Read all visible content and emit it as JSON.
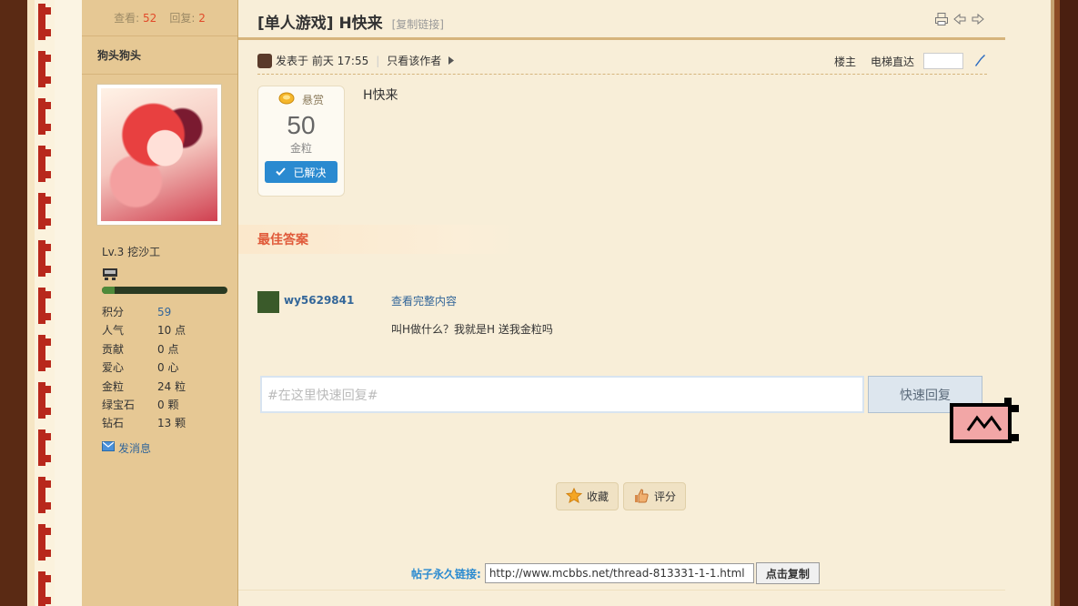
{
  "sidebar": {
    "stats": {
      "views_label": "查看:",
      "views": "52",
      "replies_label": "回复:",
      "replies": "2"
    },
    "username": "狗头狗头",
    "level": "Lv.3 挖沙工",
    "progress": 0.1,
    "fields": [
      {
        "key": "积分",
        "value": "59",
        "link": true
      },
      {
        "key": "人气",
        "value": "10 点"
      },
      {
        "key": "贡献",
        "value": "0 点"
      },
      {
        "key": "爱心",
        "value": "0 心"
      },
      {
        "key": "金粒",
        "value": "24 粒"
      },
      {
        "key": "绿宝石",
        "value": "0 颗"
      },
      {
        "key": "钻石",
        "value": "13 颗"
      }
    ],
    "message_label": "发消息"
  },
  "thread": {
    "title": "[单人游戏] H快来",
    "copy_link": "[复制链接]"
  },
  "meta": {
    "posted": "发表于 前天 17:55",
    "only_author": "只看该作者",
    "floor": "楼主",
    "elevator": "电梯直达"
  },
  "bounty": {
    "label": "悬赏",
    "amount": "50",
    "unit": "金粒",
    "status": "已解决"
  },
  "post": {
    "body": "H快来"
  },
  "best_answer": {
    "title": "最佳答案",
    "user": "wy5629841",
    "view_full": "查看完整内容",
    "text": "叫H做什么？我就是H 送我金粒吗"
  },
  "quick_reply": {
    "placeholder": "#在这里快速回复#",
    "button": "快速回复"
  },
  "actions": {
    "favorite": "收藏",
    "rate": "评分"
  },
  "permalink": {
    "label": "帖子永久链接:",
    "url": "http://www.mcbbs.net/thread-813331-1-1.html",
    "copy_button": "点击复制"
  },
  "colors": {
    "sidebar_bg": "#e6c894",
    "accent_red": "#e24a2a",
    "link_blue": "#336699",
    "solved_blue": "#2a8ad0"
  }
}
